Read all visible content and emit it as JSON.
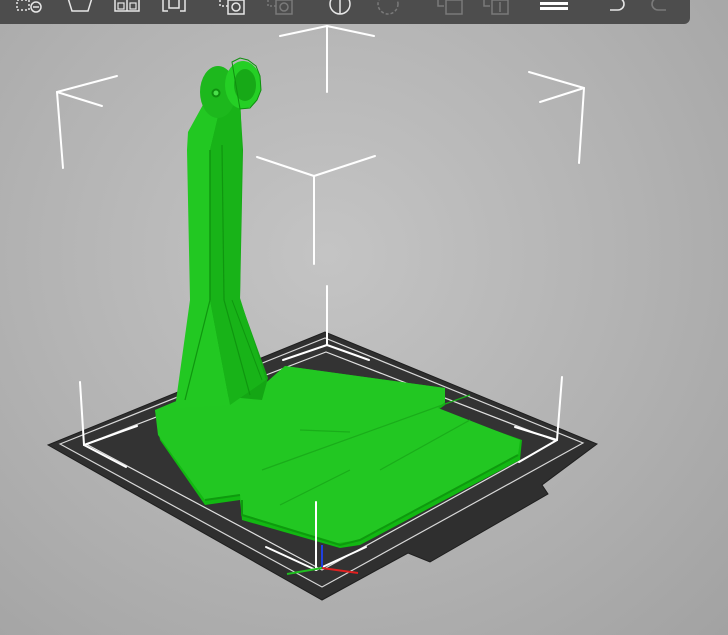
{
  "app": {
    "view": "3D plater view",
    "colors": {
      "background": "#b4b4b4",
      "toolbar": "#4d4d4d",
      "toolbar_icon": "#e6e6e6",
      "toolbar_icon_disabled": "#7a7a7a",
      "model": "#1fc21f",
      "bed": "#2f2f2f",
      "bed_outline": "#d8d8d8",
      "bounding_box": "#ffffff",
      "axis_x": "#e02020",
      "axis_y": "#20c020",
      "axis_z": "#2040e0"
    }
  },
  "toolbar": {
    "items": [
      {
        "icon": "delete-all-icon",
        "enabled": true
      },
      {
        "icon": "arrange-icon",
        "enabled": true
      },
      {
        "icon": "copy-icon",
        "enabled": true
      },
      {
        "icon": "paste-icon",
        "enabled": true
      },
      {
        "icon": "add-instance-icon",
        "enabled": true
      },
      {
        "icon": "remove-instance-icon",
        "enabled": false
      },
      {
        "icon": "split-objects-icon",
        "enabled": true
      },
      {
        "icon": "split-parts-icon",
        "enabled": false
      },
      {
        "icon": "layers-editing-icon",
        "enabled": false
      },
      {
        "icon": "search-icon",
        "enabled": false
      },
      {
        "icon": "layers-icon",
        "enabled": true
      },
      {
        "icon": "undo-icon",
        "enabled": true
      },
      {
        "icon": "redo-icon",
        "enabled": false
      }
    ]
  },
  "scene": {
    "object": "phone-stand-model",
    "bed": "print-bed"
  }
}
